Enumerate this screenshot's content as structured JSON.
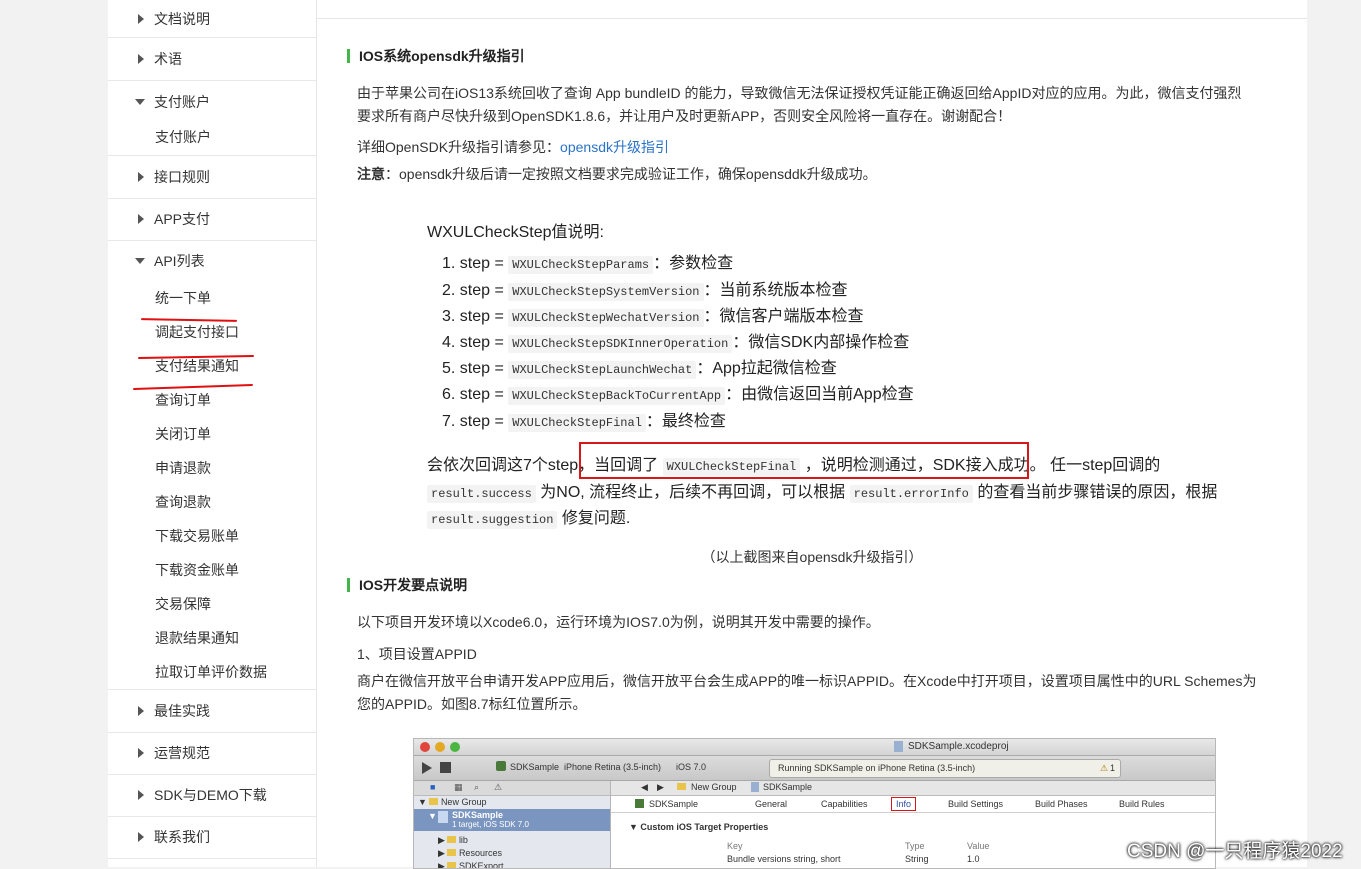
{
  "sidebar": {
    "items": [
      {
        "label": "文档说明",
        "expanded": false
      },
      {
        "label": "术语",
        "expanded": false
      },
      {
        "label": "支付账户",
        "expanded": true
      },
      {
        "label": "接口规则",
        "expanded": false
      },
      {
        "label": "APP支付",
        "expanded": false
      },
      {
        "label": "API列表",
        "expanded": true
      },
      {
        "label": "最佳实践",
        "expanded": false
      },
      {
        "label": "运营规范",
        "expanded": false
      },
      {
        "label": "SDK与DEMO下载",
        "expanded": false
      },
      {
        "label": "联系我们",
        "expanded": false
      }
    ],
    "account_sub": [
      "支付账户"
    ],
    "api_sub": [
      "统一下单",
      "调起支付接口",
      "支付结果通知",
      "查询订单",
      "关闭订单",
      "申请退款",
      "查询退款",
      "下载交易账单",
      "下载资金账单",
      "交易保障",
      "退款结果通知",
      "拉取订单评价数据"
    ]
  },
  "main": {
    "section1_title": "IOS系统opensdk升级指引",
    "para1_line1": "由于苹果公司在iOS13系统回收了查询 App bundleID 的能力，导致微信无法保证授权凭证能正确返回给AppID对应的应用。为此，微信支付强烈",
    "para1_line2": "要求所有商户尽快升级到OpenSDK1.8.6，并让用户及时更新APP，否则安全风险将一直存在。谢谢配合！",
    "detail_prefix": "详细OpenSDK升级指引请参见：",
    "detail_link": "opensdk升级指引",
    "note_label": "注意",
    "note_text": "：opensdk升级后请一定按照文档要求完成验证工作，确保opensddk升级成功。",
    "shot": {
      "heading": "WXULCheckStep值说明:",
      "steps": [
        {
          "num": "1. step =",
          "code": "WXULCheckStepParams",
          "desc": "：参数检查"
        },
        {
          "num": "2. step =",
          "code": "WXULCheckStepSystemVersion",
          "desc": "：当前系统版本检查"
        },
        {
          "num": "3. step =",
          "code": "WXULCheckStepWechatVersion",
          "desc": "：微信客户端版本检查"
        },
        {
          "num": "4. step =",
          "code": "WXULCheckStepSDKInnerOperation",
          "desc": "：微信SDK内部操作检查"
        },
        {
          "num": "5. step =",
          "code": "WXULCheckStepLaunchWechat",
          "desc": "：App拉起微信检查"
        },
        {
          "num": "6. step =",
          "code": "WXULCheckStepBackToCurrentApp",
          "desc": "：由微信返回当前App检查"
        },
        {
          "num": "7. step =",
          "code": "WXULCheckStepFinal",
          "desc": "：最终检查"
        }
      ],
      "l1_a": "会依次回调这7个step",
      "l1_b": "，当回调了",
      "l1_code": "WXULCheckStepFinal",
      "l1_c": "，说明检测通过，SDK接入成功。",
      "l1_d": "任一step回调的",
      "l2_code1": "result.success",
      "l2_a": "为NO, 流程终止，后续不再回调，可以根据",
      "l2_code2": "result.errorInfo",
      "l2_b": "的查看当前步骤错误的原因，根据",
      "l3_code": "result.suggestion",
      "l3_a": "修复问题."
    },
    "caption": "（以上截图来自opensdk升级指引）",
    "section2_title": "IOS开发要点说明",
    "para2": "以下项目开发环境以Xcode6.0，运行环境为IOS7.0为例，说明其开发中需要的操作。",
    "step1": "1、项目设置APPID",
    "para3_line1": "商户在微信开放平台申请开发APP应用后，微信开放平台会生成APP的唯一标识APPID。在Xcode中打开项目，设置项目属性中的URL Schemes为",
    "para3_line2": "您的APPID。如图8.7标红位置所示。",
    "xcode": {
      "title": "SDKSample.xcodeproj",
      "scheme": "SDKSample",
      "device": "iPhone Retina (3.5-inch)",
      "os": "iOS 7.0",
      "status": "Running SDKSample on iPhone Retina (3.5-inch)",
      "warn_count": "1",
      "jump_group": "New Group",
      "jump_file": "SDKSample",
      "tree_group": "New Group",
      "tree_proj": "SDKSample",
      "tree_proj_sub": "1 target, iOS SDK 7.0",
      "tree_items": [
        "lib",
        "Resources",
        "SDKExport"
      ],
      "target": "SDKSample",
      "tabs": [
        "General",
        "Capabilities",
        "Info",
        "Build Settings",
        "Build Phases",
        "Build Rules"
      ],
      "section": "Custom iOS Target Properties",
      "col_key": "Key",
      "col_type": "Type",
      "col_value": "Value",
      "row_key": "Bundle versions string, short",
      "row_type": "String",
      "row_value": "1.0"
    }
  },
  "watermark": "CSDN @一只程序猿2022"
}
